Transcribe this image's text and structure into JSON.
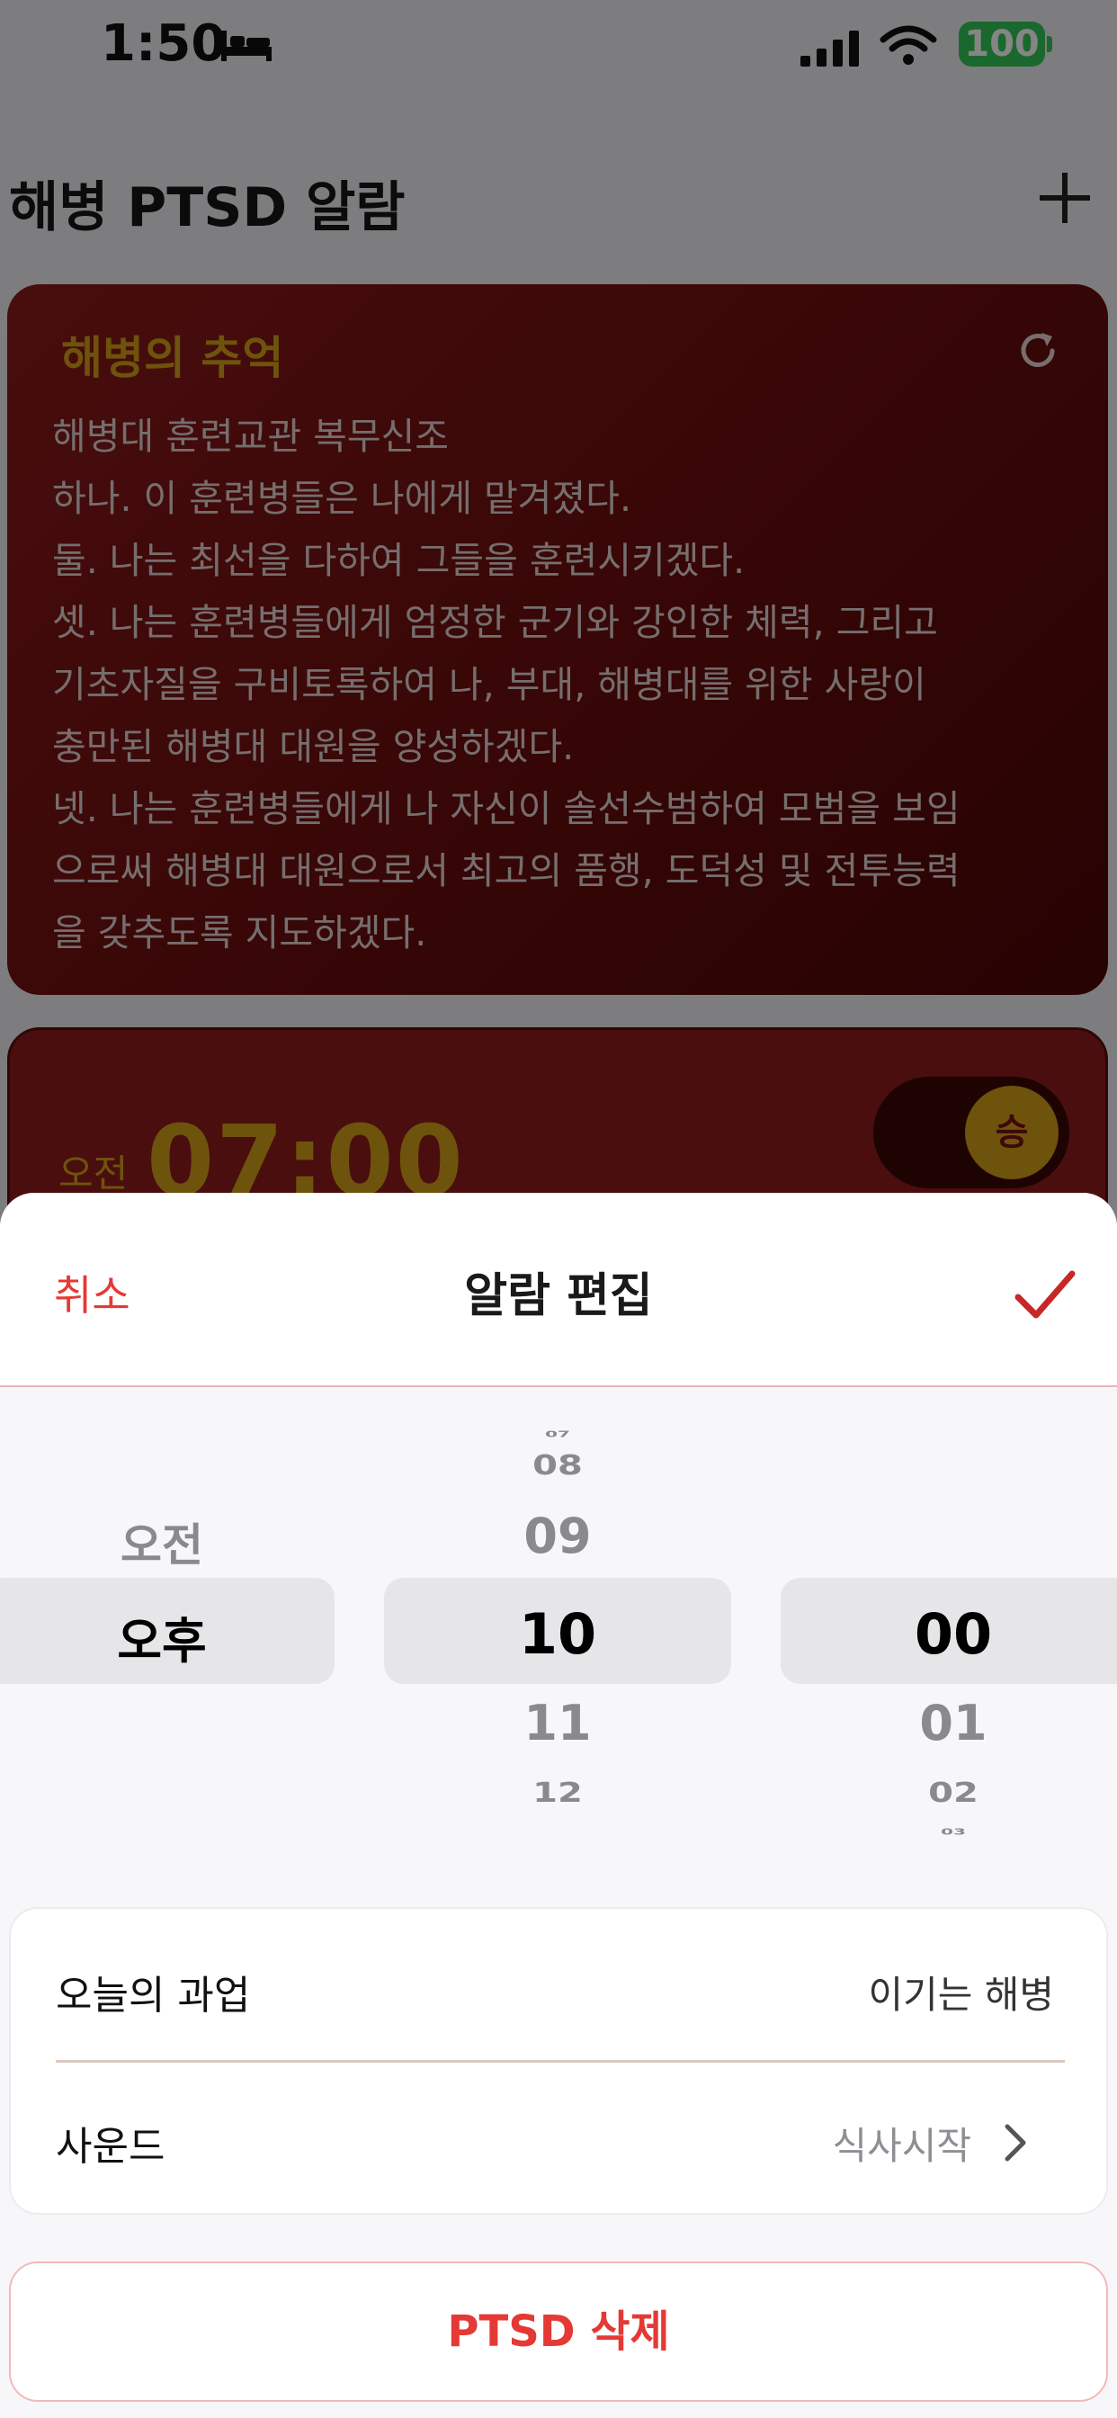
{
  "status_bar": {
    "time": "1:50",
    "battery": "100",
    "battery_color": "#34c759",
    "icons": [
      "bed-icon",
      "signal-icon",
      "wifi-icon"
    ]
  },
  "background_screen": {
    "title": "해병 PTSD 알람",
    "add_icon": "plus-icon",
    "memory_card": {
      "title": "해병의 추억",
      "refresh_icon": "refresh-icon",
      "lines": [
        "해병대 훈련교관 복무신조",
        "하나. 이 훈련병들은 나에게 맡겨졌다.",
        "둘. 나는 최선을 다하여 그들을 훈련시키겠다.",
        "셋. 나는 훈련병들에게 엄정한 군기와 강인한 체력, 그리고",
        "기초자질을 구비토록하여 나, 부대, 해병대를 위한 사랑이",
        "충만된 해병대 대원을 양성하겠다.",
        "넷. 나는 훈련병들에게 나 자신이 솔선수범하여 모범을 보임",
        "으로써 해병대 대원으로서 최고의 품행, 도덕성 및 전투능력",
        "을 갖추도록 지도하겠다."
      ]
    },
    "alarm_card": {
      "ampm": "오전",
      "time": "07:00",
      "toggle_label": "승",
      "toggle_on": true
    },
    "accent_gold": "#d4a017",
    "card_red": "#8b1a1a"
  },
  "sheet": {
    "cancel": "취소",
    "title": "알람 편집",
    "confirm_icon": "checkmark-icon",
    "picker": {
      "ampm": {
        "items": [
          "오전",
          "오후"
        ],
        "selected": "오후"
      },
      "hour": {
        "items": [
          "07",
          "08",
          "09",
          "10",
          "11",
          "12"
        ],
        "selected": "10"
      },
      "minute": {
        "items": [
          "00",
          "01",
          "02",
          "03"
        ],
        "selected": "00"
      }
    },
    "settings": {
      "task_label": "오늘의 과업",
      "task_value": "이기는 해병",
      "sound_label": "사운드",
      "sound_value": "식사시작",
      "sound_chevron": "chevron-right-icon"
    },
    "delete_label": "PTSD 삭제",
    "accent_red": "#e53935"
  }
}
